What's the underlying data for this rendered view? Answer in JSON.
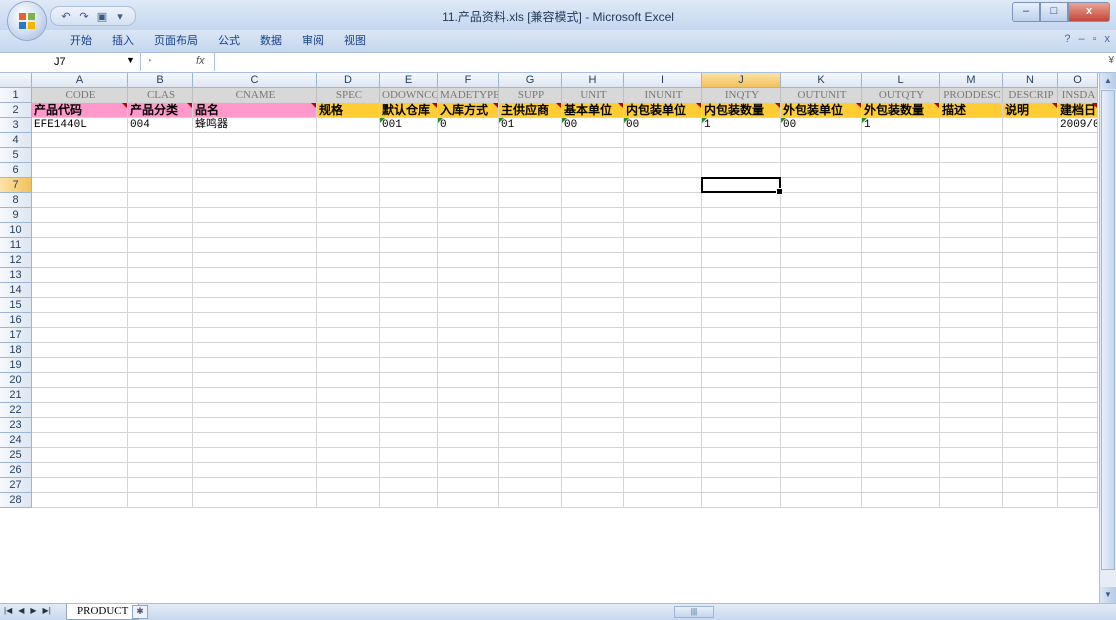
{
  "window": {
    "title": "11.产品资料.xls  [兼容模式] - Microsoft Excel",
    "controls": [
      "–",
      "□",
      "x"
    ]
  },
  "qat": {
    "undo": "↶",
    "redo": "↷",
    "save": "▣",
    "customize": "▾"
  },
  "ribbon": {
    "tabs": [
      "开始",
      "插入",
      "页面布局",
      "公式",
      "数据",
      "审阅",
      "视图"
    ],
    "right": {
      "help": "?",
      "minimize": "–",
      "restore": "▫",
      "close": "x"
    }
  },
  "formula_bar": {
    "name_box": "J7",
    "fx_label": "fx",
    "formula": ""
  },
  "grid": {
    "column_letters": [
      "A",
      "B",
      "C",
      "D",
      "E",
      "F",
      "G",
      "H",
      "I",
      "J",
      "K",
      "L",
      "M",
      "N",
      "O"
    ],
    "selected_column": "J",
    "row_numbers": [
      "1",
      "2",
      "3",
      "4",
      "5",
      "6",
      "7",
      "8",
      "9",
      "10",
      "11",
      "12",
      "13",
      "14",
      "15",
      "16",
      "17",
      "18",
      "19",
      "20",
      "21",
      "22",
      "23",
      "24",
      "25",
      "26",
      "27",
      "28"
    ],
    "selected_row": "7",
    "row1": [
      "CODE",
      "CLAS",
      "CNAME",
      "SPEC",
      "ODOWNCOD",
      "MADETYPE",
      "SUPP",
      "UNIT",
      "INUNIT",
      "INQTY",
      "OUTUNIT",
      "OUTQTY",
      "PRODDESC",
      "DESCRIP",
      "INSDA"
    ],
    "row2": [
      "产品代码",
      "产品分类",
      "品名",
      "规格",
      "默认仓库",
      "入库方式",
      "主供应商",
      "基本单位",
      "内包装单位",
      "内包装数量",
      "外包装单位",
      "外包装数量",
      "描述",
      "说明",
      "建档日"
    ],
    "row3": [
      "EFE1440L",
      "004",
      "蜂鸣器",
      "",
      "001",
      "0",
      "01",
      "00",
      "00",
      "1",
      "00",
      "1",
      "",
      "",
      "2009/0"
    ]
  },
  "sheet": {
    "nav": [
      "|◀",
      "◀",
      "▶",
      "▶|"
    ],
    "active_tab": "PRODUCT",
    "new_sheet_icon": "✱"
  },
  "scrollbar": {
    "h_thumb": "|||"
  }
}
